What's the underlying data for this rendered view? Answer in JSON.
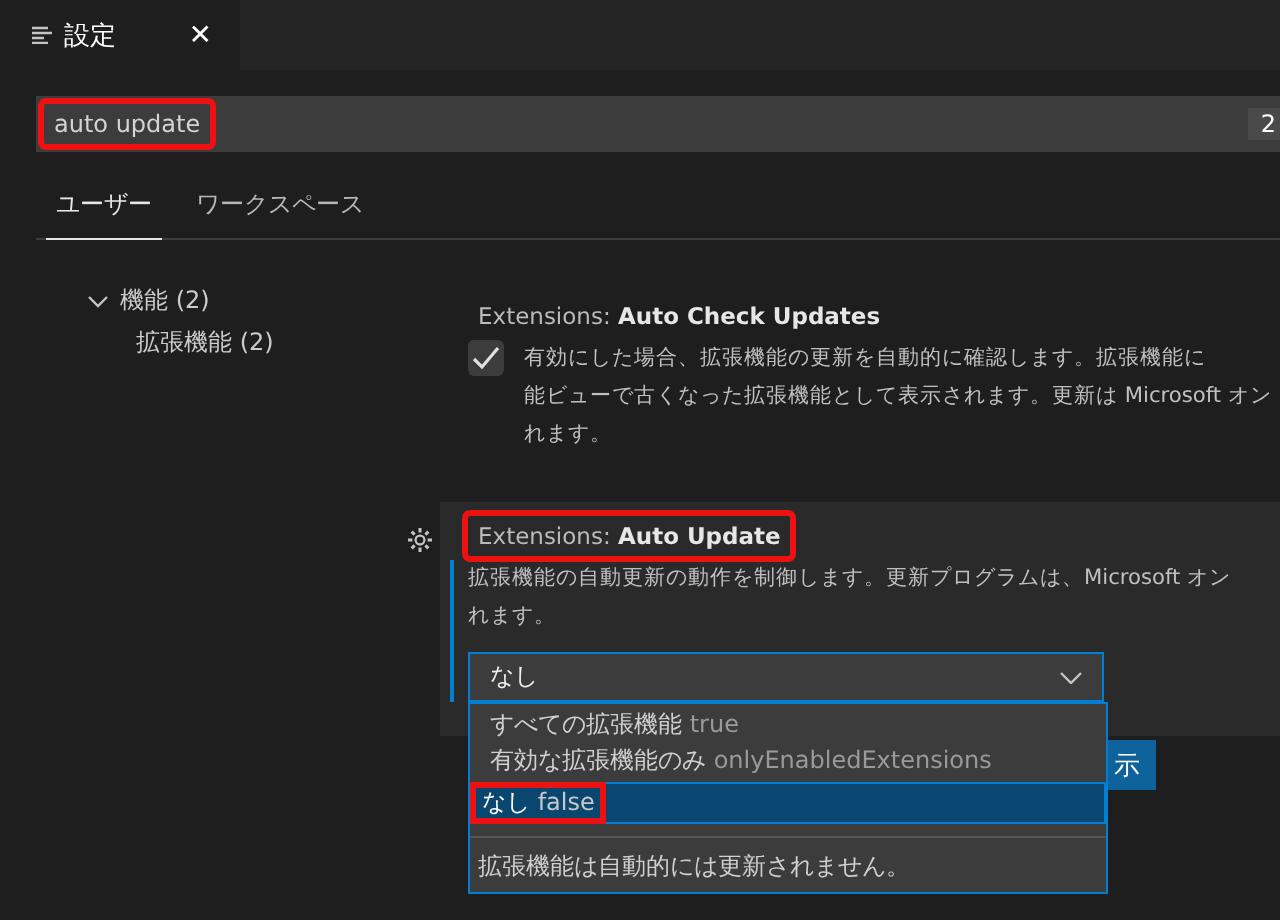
{
  "editor_tab": {
    "title": "設定",
    "close": "✕"
  },
  "search": {
    "value": "auto update",
    "count": "2",
    "highlighted": true
  },
  "scope_tabs": [
    {
      "label": "ユーザー",
      "selected": true
    },
    {
      "label": "ワークスペース",
      "selected": false
    }
  ],
  "tree": [
    {
      "label": "機能 (2)",
      "expanded": true,
      "children": [
        {
          "label": "拡張機能 (2)"
        }
      ]
    }
  ],
  "settings": [
    {
      "kind": "checkbox",
      "category": "Extensions: ",
      "name": "Auto Check Updates",
      "highlighted": false,
      "focused": false,
      "checked": true,
      "description_lines": [
        "有効にした場合、拡張機能の更新を自動的に確認します。拡張機能に",
        "能ビューで古くなった拡張機能として表示されます。更新は Microsoft オン",
        "れます。"
      ]
    },
    {
      "kind": "dropdown",
      "category": "Extensions: ",
      "name": "Auto Update",
      "highlighted": true,
      "focused": true,
      "description_lines": [
        "拡張機能の自動更新の動作を制御します。更新プログラムは、Microsoft オン",
        "れます。"
      ],
      "value": "なし",
      "open": true,
      "options": [
        {
          "label": "すべての拡張機能",
          "value": "true",
          "selected": false,
          "highlighted": false
        },
        {
          "label": "有効な拡張機能のみ",
          "value": "onlyEnabledExtensions",
          "selected": false,
          "highlighted": false
        },
        {
          "label": "なし",
          "value": "false",
          "selected": true,
          "highlighted": true
        }
      ],
      "option_description": "拡張機能は自動的には更新されません。",
      "button_label": "示"
    }
  ]
}
